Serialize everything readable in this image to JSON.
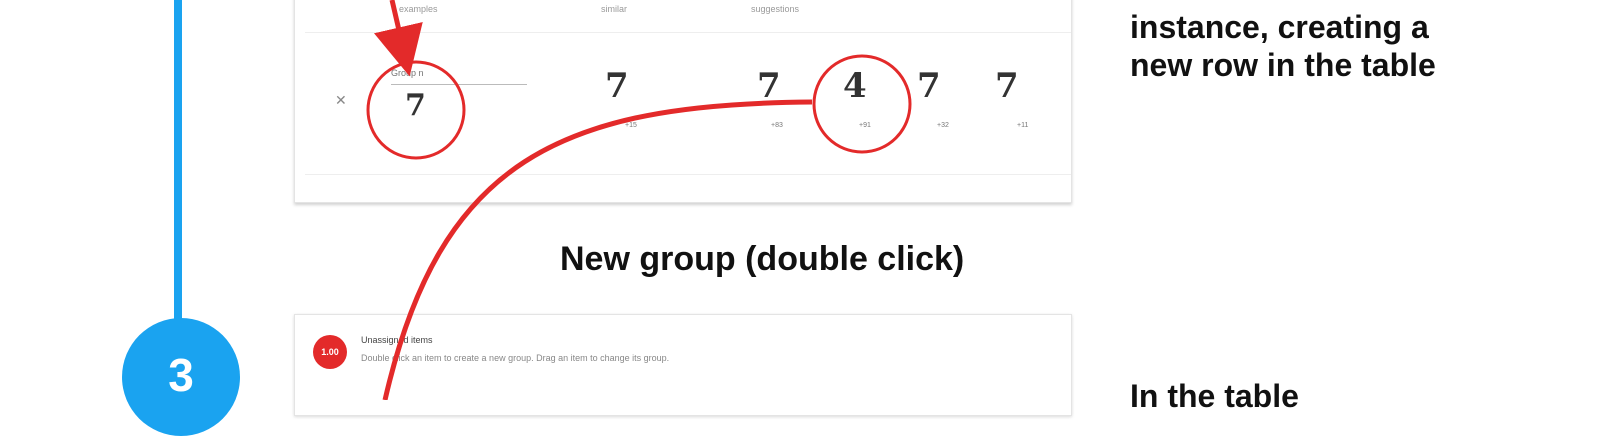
{
  "step": {
    "number": "3"
  },
  "top_card": {
    "col_headers": [
      "examples",
      "similar",
      "suggestions"
    ],
    "group_placeholder": "Group n",
    "remove_symbol": "✕",
    "selected_digit": "7",
    "digits": [
      {
        "digit": "7",
        "caption": "+15"
      },
      {
        "digit": "7",
        "caption": "+83"
      },
      {
        "digit": "4",
        "caption": "+91"
      },
      {
        "digit": "7",
        "caption": "+32"
      },
      {
        "digit": "7",
        "caption": "+11"
      }
    ]
  },
  "caption": "New group (double click)",
  "bottom_card": {
    "icon_text": "1.00",
    "title": "Unassigned items",
    "description": "Double click an item to create a new group. Drag an item to change its group."
  },
  "side_text": {
    "lines": [
      "instance, creating a",
      "new row in the table"
    ],
    "bottom": "In the table"
  },
  "colors": {
    "accent_blue": "#1aa3f0",
    "annotation_red": "#e32a2a"
  }
}
